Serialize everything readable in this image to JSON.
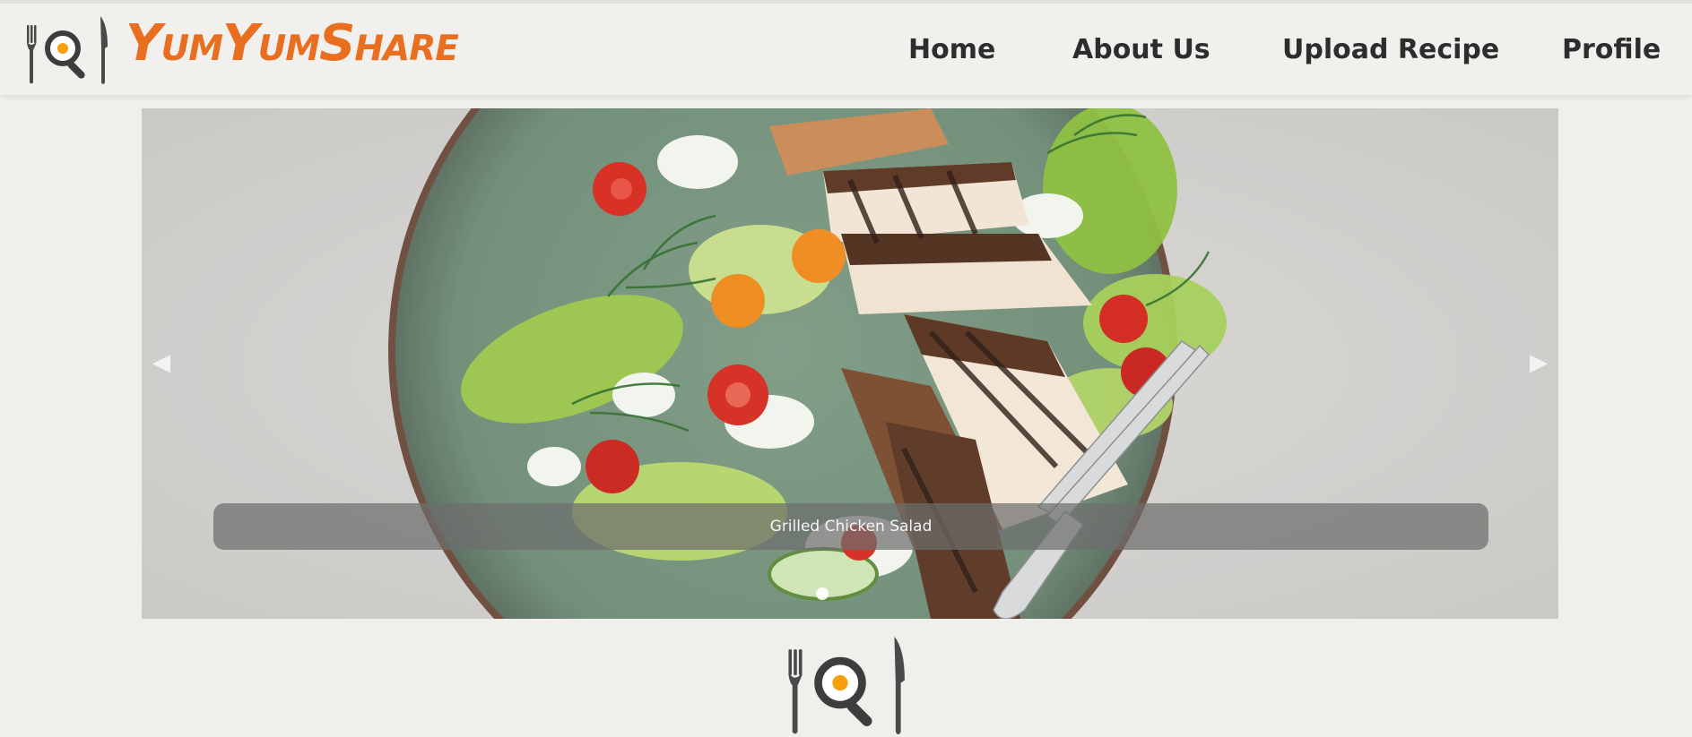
{
  "header": {
    "brand": "YumYumShare",
    "brand_color": "#e86f1f",
    "logo_icon": "fork-magnifier-egg-knife-icon",
    "nav": [
      {
        "label": "Home"
      },
      {
        "label": "About Us"
      },
      {
        "label": "Upload Recipe"
      },
      {
        "label": "Profile"
      }
    ]
  },
  "carousel": {
    "slides": [
      {
        "caption": "Grilled Chicken Salad",
        "image": "grilled-chicken-salad-photo"
      }
    ],
    "active_index": 0,
    "prev_icon": "chevron-left-icon",
    "next_icon": "chevron-right-icon"
  },
  "footer": {
    "logo_icon": "fork-magnifier-egg-knife-icon"
  }
}
